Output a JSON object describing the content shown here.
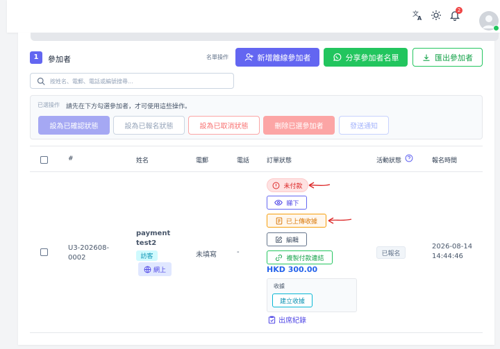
{
  "topbar": {
    "icons": [
      "translate-icon",
      "sun-icon",
      "bell-icon"
    ],
    "notification_count": "2"
  },
  "header": {
    "count": "1",
    "title": "參加者",
    "list_ops_label": "名單操作",
    "add_offline_label": "新增離線參加者",
    "share_list_label": "分享參加者名單",
    "export_label": "匯出參加者"
  },
  "search": {
    "placeholder": "按姓名、電郵、電話或編號搜尋..."
  },
  "bulk": {
    "label": "已選操作",
    "hint": "請先在下方勾選參加者，才可使用這些操作。",
    "buttons": [
      "設為已確認狀態",
      "設為已報名狀態",
      "設為已取消狀態",
      "刪除已選參加者",
      "發送通知"
    ]
  },
  "table": {
    "columns": [
      "#",
      "姓名",
      "電郵",
      "電話",
      "訂單狀態",
      "活動狀態",
      "報名時間"
    ],
    "rows": [
      {
        "id_line1": "U3-202608-",
        "id_line2": "0002",
        "name_line1": "payment",
        "name_line2": "test2",
        "visitor_tag": "訪客",
        "online_tag": "網上",
        "email": "未填寫",
        "phone": "-",
        "order": {
          "unpaid_label": "未付款",
          "view_label": "睇下",
          "receipt_uploaded_label": "已上傳收據",
          "edit_label": "編輯",
          "copy_link_label": "複製付款連結",
          "amount": "HKD 300.00",
          "receipt_section_label": "收據",
          "create_receipt_label": "建立收據",
          "attendance_label": "出席紀錄"
        },
        "activity_status": "已報名",
        "time_line1": "2026-08-14",
        "time_line2": "14:44:46"
      }
    ]
  },
  "colors": {
    "primary": "#6366f1",
    "whatsapp": "#22c55e",
    "danger": "#ef4444",
    "warning": "#f59e0b",
    "amount": "#2563eb",
    "annotation": "#dc2626"
  }
}
